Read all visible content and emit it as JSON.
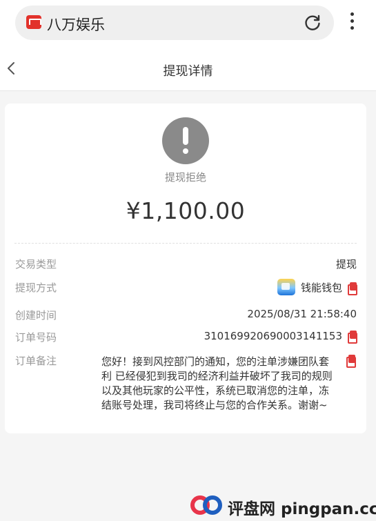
{
  "browser": {
    "site_name": "八万娱乐",
    "logo_icon": "site-logo-icon",
    "reload_icon": "reload-icon",
    "menu_icon": "kebab-menu-icon"
  },
  "nav": {
    "title": "提现详情",
    "back_icon": "chevron-left-icon"
  },
  "status": {
    "icon": "exclamation-circle-icon",
    "text": "提现拒绝",
    "amount": "¥1,100.00"
  },
  "details": {
    "type": {
      "label": "交易类型",
      "value": "提现"
    },
    "method": {
      "label": "提现方式",
      "value": "钱能钱包",
      "icon": "wallet-app-icon"
    },
    "created": {
      "label": "创建时间",
      "value": "2025/08/31 21:58:40"
    },
    "order_no": {
      "label": "订单号码",
      "value": "3101699206900031411​53"
    },
    "remark": {
      "label": "订单备注",
      "value": "您好！接到风控部门的通知，您的注单涉嫌团队套利 已经侵犯到我司的经济利益并破坏了我司的规则以及其他玩家的公平性，系统已取消您的注单，冻结账号处理，我司将终止与您的合作关系。谢谢~"
    }
  },
  "watermark": {
    "text": "评盘网 pingpan.cc",
    "colors": [
      "#e8344a",
      "#1f5fbf"
    ]
  },
  "colors": {
    "accent_red": "#e03a3a",
    "status_gray": "#8a8a8a"
  }
}
